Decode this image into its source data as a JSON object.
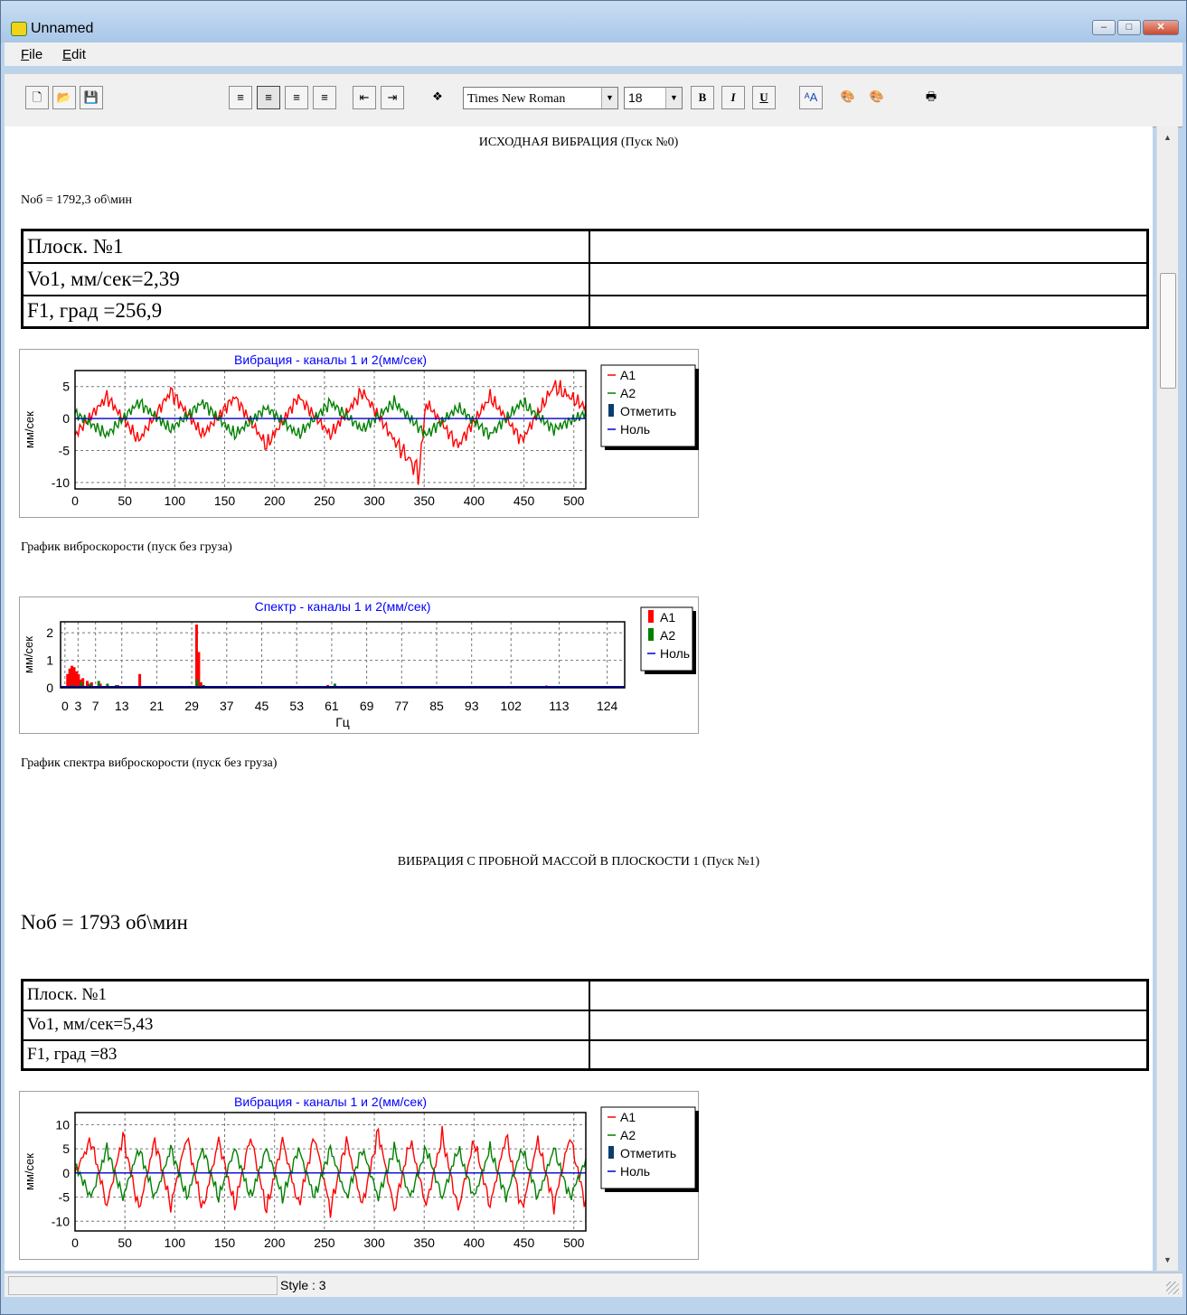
{
  "window": {
    "title": "Unnamed",
    "minimize": "–",
    "maximize": "□",
    "close": "✕"
  },
  "menu": [
    "File",
    "Edit"
  ],
  "toolbar": {
    "font": "Times New Roman",
    "size": "18",
    "bold": "B",
    "italic": "I",
    "underline": "U"
  },
  "status": {
    "style": "Style : 3"
  },
  "doc": {
    "heading0": "ИСХОДНАЯ ВИБРАЦИЯ (Пуск №0)",
    "nob0": "Noб = 1792,3 об\\мин",
    "table0": [
      [
        "Плоск. №1",
        ""
      ],
      [
        "Vo1, мм/сек=2,39",
        ""
      ],
      [
        "F1, град =256,9",
        ""
      ]
    ],
    "caption_time0": "График виброскорости (пуск без груза)",
    "caption_spec0": "График спектра  виброскорости (пуск без груза)",
    "heading1": "ВИБРАЦИЯ С ПРОБНОЙ МАССОЙ В ПЛОСКОСТИ 1  (Пуск №1)",
    "nob1": "Noб = 1793 об\\мин",
    "table1": [
      [
        "Плоск. №1",
        ""
      ],
      [
        "Vo1, мм/сек=5,43",
        ""
      ],
      [
        "F1, град =83",
        ""
      ]
    ]
  },
  "colors": {
    "a1": "#ff0000",
    "a2": "#008000",
    "null": "#0000cc",
    "mark": "#0b3d6e",
    "title": "#0000ff"
  },
  "chart_data": [
    {
      "type": "line",
      "title": "Вибрация - каналы 1 и 2(мм/сек)",
      "xlabel": "",
      "ylabel": "мм/сек",
      "xlim": [
        0,
        512
      ],
      "ylim": [
        -11,
        7.5
      ],
      "xticks": [
        0,
        50,
        100,
        150,
        200,
        250,
        300,
        350,
        400,
        450,
        500
      ],
      "yticks": [
        5,
        0,
        -5,
        -10
      ],
      "legend": [
        "A1",
        "A2",
        "Отметить",
        "Ноль"
      ],
      "legend_position": "right",
      "grid": true,
      "series": [
        {
          "name": "A1",
          "description": "oscillating ~±4, minimum about -10 near x=345",
          "x": [
            0,
            32,
            64,
            96,
            128,
            160,
            192,
            224,
            256,
            288,
            320,
            345,
            352,
            384,
            416,
            448,
            480,
            512
          ],
          "y": [
            -3,
            4,
            -4,
            5,
            -3,
            4,
            -5,
            4,
            -3,
            5,
            -4,
            -10,
            3,
            -5,
            4,
            -4,
            6,
            2
          ]
        },
        {
          "name": "A2",
          "description": "oscillating ~±3",
          "x": [
            0,
            32,
            64,
            96,
            128,
            160,
            192,
            224,
            256,
            288,
            320,
            352,
            384,
            416,
            448,
            480,
            512
          ],
          "y": [
            1,
            -3,
            3,
            -2,
            3,
            -3,
            2,
            -3,
            3,
            -2,
            3,
            -3,
            2,
            -3,
            3,
            -2,
            1
          ]
        },
        {
          "name": "Ноль",
          "x": [
            0,
            512
          ],
          "y": [
            0,
            0
          ]
        }
      ]
    },
    {
      "type": "bar",
      "title": "Спектр - каналы 1 и 2(мм/сек)",
      "xlabel": "Гц",
      "ylabel": "мм/сек",
      "xlim": [
        -1,
        128
      ],
      "ylim": [
        0,
        2.4
      ],
      "xticks": [
        "0",
        "3",
        "7",
        "13",
        "21",
        "29",
        "37",
        "45",
        "53",
        "61",
        "69",
        "77",
        "85",
        "93",
        "102",
        "113",
        "124"
      ],
      "yticks": [
        2,
        1,
        0
      ],
      "legend": [
        "A1",
        "A2",
        "Ноль"
      ],
      "legend_position": "right",
      "grid": true,
      "series": [
        {
          "name": "A1",
          "x": [
            0.5,
            1,
            1.5,
            2,
            2.5,
            3,
            3.5,
            4,
            5,
            6,
            8,
            12,
            17,
            30,
            30.5,
            31,
            60,
            91,
            110
          ],
          "y": [
            0.5,
            0.7,
            0.8,
            0.75,
            0.6,
            0.5,
            0.3,
            0.35,
            0.25,
            0.2,
            0.15,
            0.1,
            0.5,
            2.3,
            1.3,
            0.2,
            0.1,
            0.05,
            0.08
          ]
        },
        {
          "name": "A2",
          "x": [
            1,
            3,
            5,
            7,
            9,
            11,
            15,
            20,
            29.5,
            31,
            40,
            61,
            85,
            110
          ],
          "y": [
            0.1,
            0.2,
            0.15,
            0.25,
            0.15,
            0.1,
            0.05,
            0.05,
            0.3,
            0.1,
            0.05,
            0.15,
            0.05,
            0.05
          ]
        }
      ]
    },
    {
      "type": "line",
      "title": "Вибрация - каналы 1 и 2(мм/сек)",
      "xlabel": "",
      "ylabel": "мм/сек",
      "xlim": [
        0,
        512
      ],
      "ylim": [
        -12,
        12.5
      ],
      "xticks": [
        0,
        50,
        100,
        150,
        200,
        250,
        300,
        350,
        400,
        450,
        500
      ],
      "yticks": [
        10,
        5,
        0,
        -5,
        -10
      ],
      "legend": [
        "A1",
        "A2",
        "Отметить",
        "Ноль"
      ],
      "legend_position": "right",
      "grid": true,
      "series": [
        {
          "name": "A1",
          "description": "regular oscillation amplitude ~9",
          "x": [
            0,
            16,
            32,
            48,
            64,
            80,
            96,
            112,
            128,
            144,
            160,
            176,
            192,
            208,
            224,
            240,
            256,
            272,
            288,
            304,
            320,
            336,
            352,
            368,
            384,
            400,
            416,
            432,
            448,
            464,
            480,
            496,
            512
          ],
          "y": [
            0,
            8,
            -8,
            9,
            -9,
            8,
            -8,
            9,
            -9,
            8,
            -8,
            9,
            -9,
            8,
            -8,
            9,
            -9,
            8,
            -8,
            10,
            -9,
            8,
            -8,
            9,
            -9,
            8,
            -8,
            9,
            -9,
            8,
            -8,
            9,
            -8
          ]
        },
        {
          "name": "A2",
          "description": "regular oscillation amplitude ~6",
          "x": [
            0,
            16,
            32,
            48,
            64,
            80,
            96,
            112,
            128,
            144,
            160,
            176,
            192,
            208,
            224,
            240,
            256,
            272,
            288,
            304,
            320,
            336,
            352,
            368,
            384,
            400,
            416,
            432,
            448,
            464,
            480,
            496,
            512
          ],
          "y": [
            2,
            -6,
            6,
            -6,
            6,
            -6,
            6,
            -6,
            6,
            -6,
            6,
            -6,
            6,
            -6,
            6,
            -6,
            6,
            -6,
            6,
            -6,
            6,
            -6,
            6,
            -6,
            6,
            -6,
            6,
            -6,
            6,
            -6,
            6,
            -6,
            3
          ]
        },
        {
          "name": "Ноль",
          "x": [
            0,
            512
          ],
          "y": [
            0,
            0
          ]
        }
      ]
    }
  ]
}
